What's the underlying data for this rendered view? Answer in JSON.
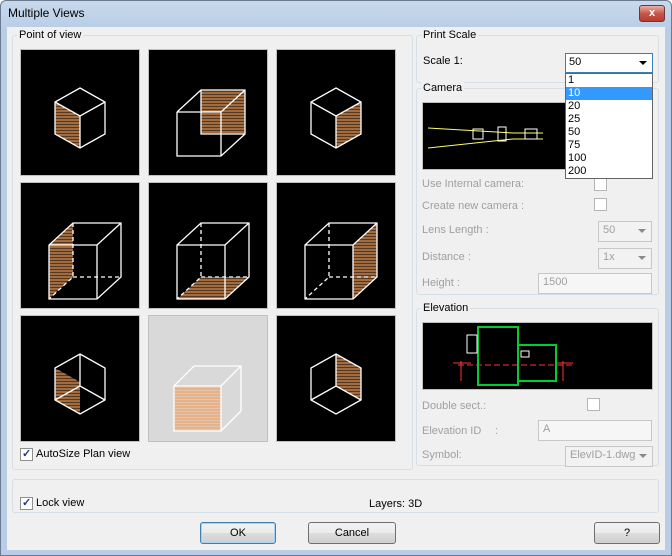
{
  "window": {
    "title": "Multiple Views",
    "close_glyph": "x"
  },
  "point_of_view": {
    "label": "Point of view",
    "autosize": {
      "label": "AutoSize Plan view",
      "checked": true
    },
    "thumbnails": [
      "iso-left-front",
      "top-front",
      "iso-right-front",
      "side-left",
      "bottom",
      "side-right",
      "iso-left-bottom",
      "plan-front",
      "iso-right-bottom"
    ],
    "selected_index": 7
  },
  "print_scale": {
    "label": "Print Scale",
    "scale_label": "Scale 1:",
    "value": "50",
    "options": [
      "1",
      "10",
      "20",
      "25",
      "50",
      "75",
      "100",
      "200"
    ],
    "highlighted": "10"
  },
  "camera": {
    "label": "Camera",
    "use_internal": {
      "label": "Use Internal camera:",
      "checked": false
    },
    "create_new": {
      "label": "Create new camera :",
      "checked": false
    },
    "lens_length": {
      "label": "Lens Length :",
      "value": "50"
    },
    "distance": {
      "label": "Distance :",
      "value": "1x"
    },
    "height": {
      "label": "Height :",
      "value": "1500"
    }
  },
  "elevation": {
    "label": "Elevation",
    "double_sect": {
      "label": "Double sect.:",
      "checked": false
    },
    "elevation_id": {
      "label": "Elevation ID",
      "colon": ":",
      "value": "A"
    },
    "symbol": {
      "label": "Symbol:",
      "value": "ElevID-1.dwg"
    }
  },
  "footer": {
    "lock_view": {
      "label": "Lock view",
      "checked": true
    },
    "layers": "Layers: 3D",
    "ok": "OK",
    "cancel": "Cancel",
    "help": "?"
  },
  "colors": {
    "hatch": "#f0a060",
    "line": "#ffffff",
    "accent": "#3399ff"
  }
}
